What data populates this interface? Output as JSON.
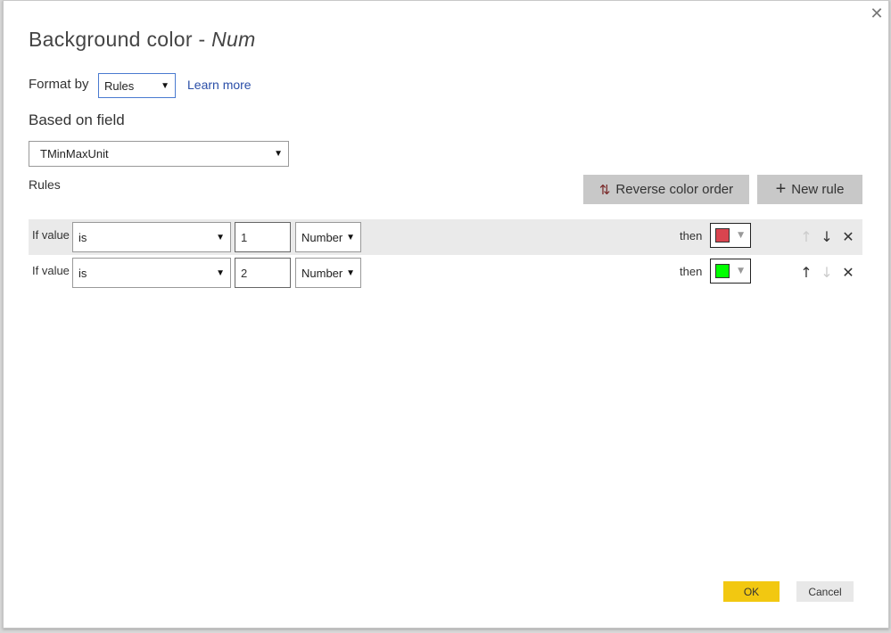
{
  "dialog": {
    "title_prefix": "Background color - ",
    "title_field": "Num",
    "close_icon": "close-icon"
  },
  "format_by": {
    "label": "Format by",
    "value": "Rules",
    "learn_more": "Learn more"
  },
  "based_on": {
    "label": "Based on field",
    "value": "TMinMaxUnit"
  },
  "rules": {
    "label": "Rules",
    "reverse_label": "Reverse color order",
    "new_rule_label": "New rule",
    "items": [
      {
        "if_label": "If value",
        "condition": "is",
        "value": "1",
        "type": "Number",
        "then_label": "then",
        "color": "#d9444f",
        "up_enabled": false,
        "down_enabled": true
      },
      {
        "if_label": "If value",
        "condition": "is",
        "value": "2",
        "type": "Number",
        "then_label": "then",
        "color": "#00ff00",
        "up_enabled": true,
        "down_enabled": false
      }
    ]
  },
  "footer": {
    "ok": "OK",
    "cancel": "Cancel"
  },
  "colors": {
    "ok": "#f2c811",
    "link": "#2b4fa8",
    "button": "#c8c8c8"
  }
}
